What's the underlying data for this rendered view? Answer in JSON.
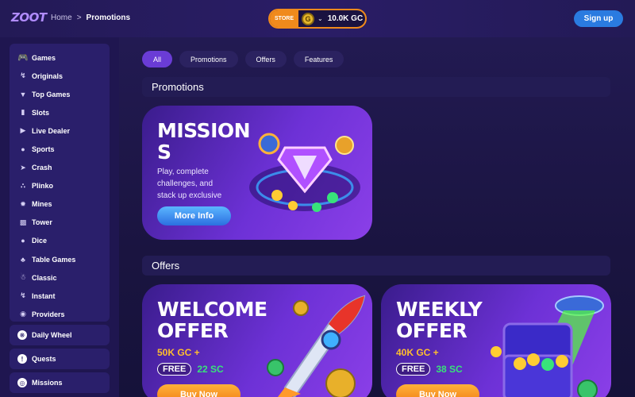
{
  "header": {
    "logo": "ZOOT",
    "breadcrumb": {
      "home": "Home",
      "separator": ">",
      "current": "Promotions"
    },
    "store": {
      "tag": "STORE",
      "coin_letter": "G",
      "balance": "10.0K GC"
    },
    "signup_label": "Sign up"
  },
  "sidebar": {
    "items": [
      {
        "label": "Games",
        "icon": "gamepad-icon"
      },
      {
        "label": "Originals",
        "icon": "bolt-icon"
      },
      {
        "label": "Top Games",
        "icon": "trophy-icon"
      },
      {
        "label": "Slots",
        "icon": "slot-icon"
      },
      {
        "label": "Live Dealer",
        "icon": "live-icon"
      },
      {
        "label": "Sports",
        "icon": "ball-icon"
      },
      {
        "label": "Crash",
        "icon": "rocket-icon"
      },
      {
        "label": "Plinko",
        "icon": "plinko-icon"
      },
      {
        "label": "Mines",
        "icon": "mine-icon"
      },
      {
        "label": "Tower",
        "icon": "tower-icon"
      },
      {
        "label": "Dice",
        "icon": "dice-icon"
      },
      {
        "label": "Table Games",
        "icon": "cards-icon"
      },
      {
        "label": "Classic",
        "icon": "classic-icon"
      },
      {
        "label": "Instant",
        "icon": "instant-icon"
      },
      {
        "label": "Providers",
        "icon": "providers-icon"
      }
    ],
    "daily_wheel": "Daily Wheel",
    "quests": "Quests",
    "missions": "Missions"
  },
  "tabs": [
    "All",
    "Promotions",
    "Offers",
    "Features"
  ],
  "sections": {
    "promotions": "Promotions",
    "offers": "Offers"
  },
  "mission_card": {
    "title": "MISSION\nS",
    "description": "Play, complete challenges, and stack up exclusive",
    "button": "More Info"
  },
  "welcome_card": {
    "title": "WELCOME\nOFFER",
    "gc": "50K GC +",
    "free": "FREE",
    "sc": "22 SC",
    "button": "Buy Now"
  },
  "weekly_card": {
    "title": "WEEKLY\nOFFER",
    "gc": "40K GC +",
    "free": "FREE",
    "sc": "38 SC",
    "button": "Buy Now"
  },
  "colors": {
    "accent": "#6a3cd6",
    "store": "#f08a1c",
    "signup": "#2a7be0",
    "gc_text": "#ffbf2e",
    "sc_text": "#38e37a"
  }
}
